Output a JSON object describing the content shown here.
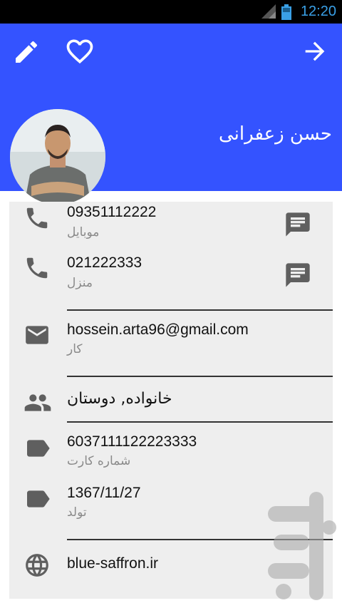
{
  "status_bar": {
    "time": "12:20"
  },
  "header": {
    "contact_name": "حسن زعفرانی",
    "icons": {
      "edit": "pencil-icon",
      "favorite": "heart-outline-icon",
      "forward": "arrow-right-icon"
    },
    "color": "#3453ff"
  },
  "details": {
    "phones": [
      {
        "number": "09351112222",
        "type": "موبایل"
      },
      {
        "number": "021222333",
        "type": "منزل"
      }
    ],
    "email": {
      "address": "hossein.arta96@gmail.com",
      "type": "کار"
    },
    "groups": "خانواده, دوستان",
    "card_number": {
      "value": "6037111122223333",
      "label": "شماره کارت"
    },
    "birthday": {
      "value": "1367/11/27",
      "label": "تولد"
    },
    "website": "blue-saffron.ir"
  }
}
